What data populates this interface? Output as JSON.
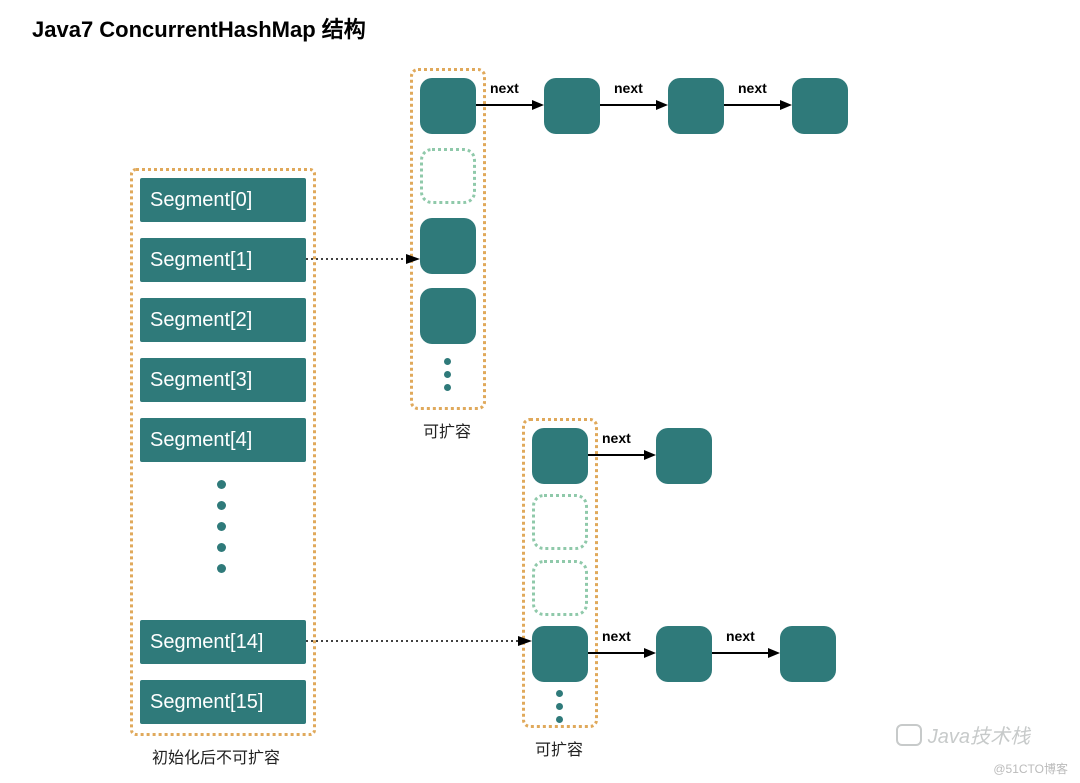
{
  "title": "Java7 ConcurrentHashMap 结构",
  "segments": {
    "items": [
      "Segment[0]",
      "Segment[1]",
      "Segment[2]",
      "Segment[3]",
      "Segment[4]",
      "Segment[14]",
      "Segment[15]"
    ],
    "caption": "初始化后不可扩容"
  },
  "column1": {
    "caption": "可扩容"
  },
  "column2": {
    "caption": "可扩容"
  },
  "arrows": {
    "next": "next"
  },
  "watermark": {
    "brand": "Java技术栈",
    "source": "@51CTO博客"
  },
  "colors": {
    "teal": "#2f7a7a",
    "dash_orange": "#e0a95b",
    "dash_green": "#8fc9aa"
  }
}
